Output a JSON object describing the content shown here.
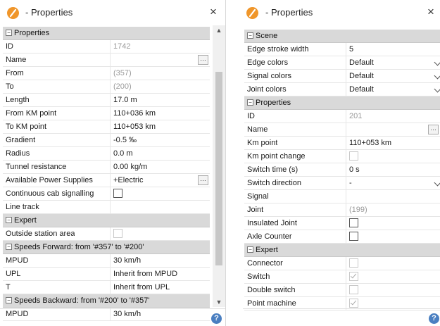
{
  "left": {
    "title": "- Properties",
    "close": "×",
    "help": "?",
    "rows": [
      {
        "kind": "group",
        "label": "Properties"
      },
      {
        "label": "ID",
        "value": "1742",
        "readonly": true
      },
      {
        "label": "Name",
        "value": "",
        "ellipsis": true
      },
      {
        "label": "From",
        "value": "(357)",
        "readonly": true
      },
      {
        "label": "To",
        "value": "(200)",
        "readonly": true
      },
      {
        "label": "Length",
        "value": "17.0 m"
      },
      {
        "label": "From KM point",
        "value": "110+036 km"
      },
      {
        "label": "To KM point",
        "value": "110+053 km"
      },
      {
        "label": "Gradient",
        "value": "-0.5 ‰"
      },
      {
        "label": "Radius",
        "value": "0.0 m"
      },
      {
        "label": "Tunnel resistance",
        "value": "0.00 kg/m"
      },
      {
        "label": "Available Power Supplies",
        "value": "+Electric",
        "ellipsis": true
      },
      {
        "label": "Continuous cab signalling",
        "checkbox": "empty"
      },
      {
        "label": "Line track",
        "value": ""
      },
      {
        "kind": "group",
        "label": "Expert"
      },
      {
        "label": "Outside station area",
        "checkbox": "disabled"
      },
      {
        "kind": "group",
        "label": "Speeds Forward: from '#357' to '#200'"
      },
      {
        "label": "MPUD",
        "value": "30 km/h"
      },
      {
        "label": "UPL",
        "value": "Inherit from MPUD"
      },
      {
        "label": "T",
        "value": "Inherit from UPL"
      },
      {
        "kind": "group",
        "label": "Speeds Backward: from '#200' to '#357'"
      },
      {
        "label": "MPUD",
        "value": "30 km/h"
      }
    ]
  },
  "right": {
    "title": "- Properties",
    "close": "×",
    "help": "?",
    "rows": [
      {
        "kind": "group",
        "label": "Scene"
      },
      {
        "label": "Edge stroke width",
        "value": "5"
      },
      {
        "label": "Edge colors",
        "value": "Default",
        "dropdown": true
      },
      {
        "label": "Signal colors",
        "value": "Default",
        "dropdown": true
      },
      {
        "label": "Joint colors",
        "value": "Default",
        "dropdown": true
      },
      {
        "kind": "group",
        "label": "Properties"
      },
      {
        "label": "ID",
        "value": "201",
        "readonly": true
      },
      {
        "label": "Name",
        "value": "",
        "ellipsis": true
      },
      {
        "label": "Km point",
        "value": "110+053 km"
      },
      {
        "label": "Km point change",
        "checkbox": "disabled"
      },
      {
        "label": "Switch time (s)",
        "value": "0 s"
      },
      {
        "label": "Switch direction",
        "value": "-",
        "dropdown": true
      },
      {
        "label": "Signal",
        "value": ""
      },
      {
        "label": "Joint",
        "value": "(199)",
        "readonly": true
      },
      {
        "label": "Insulated Joint",
        "checkbox": "empty"
      },
      {
        "label": "Axle Counter",
        "checkbox": "empty"
      },
      {
        "kind": "group",
        "label": "Expert"
      },
      {
        "label": "Connector",
        "checkbox": "disabled"
      },
      {
        "label": "Switch",
        "checkbox": "checked"
      },
      {
        "label": "Double switch",
        "checkbox": "disabled"
      },
      {
        "label": "Point machine",
        "checkbox": "checked"
      }
    ]
  }
}
